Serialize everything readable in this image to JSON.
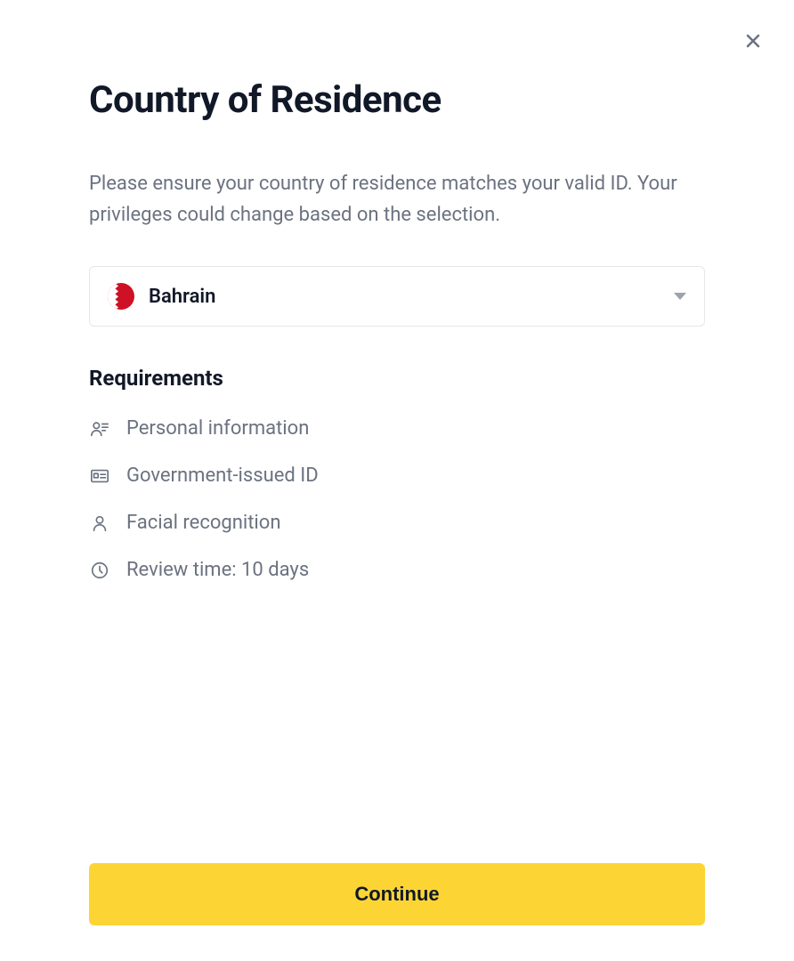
{
  "title": "Country of Residence",
  "description": "Please ensure your country of residence matches your valid ID. Your privileges could change based on the selection.",
  "country": {
    "name": "Bahrain"
  },
  "requirements": {
    "heading": "Requirements",
    "items": [
      "Personal information",
      "Government-issued ID",
      "Facial recognition",
      "Review time: 10 days"
    ]
  },
  "continue_label": "Continue"
}
